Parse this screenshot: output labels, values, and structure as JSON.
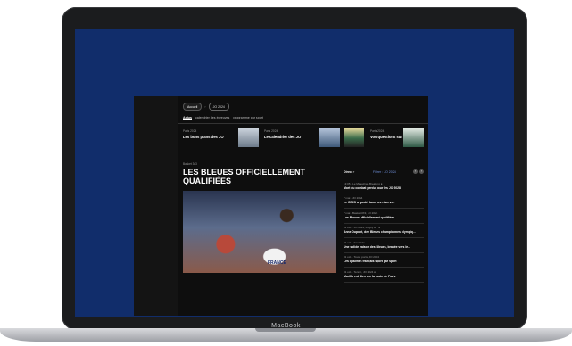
{
  "device": {
    "brand": "MacBook"
  },
  "site": {
    "pills": [
      {
        "label": "Accueil",
        "active": true
      },
      {
        "label": "JO 2024",
        "active": false
      }
    ],
    "pill_separator": "›",
    "subnav": [
      {
        "label": "Actus",
        "active": true
      },
      {
        "label": "calendrier des épreuves",
        "active": false
      },
      {
        "label": "programme par sport",
        "active": false
      }
    ],
    "cards": [
      {
        "tag": "Paris 2024",
        "title": "Les bons plans des JO",
        "thumb": "thumb1"
      },
      {
        "tag": "Paris 2024",
        "title": "Le calendrier des JO",
        "thumb": "thumb2"
      },
      {
        "tag": "Paris 2024",
        "title": "Vos questions sur les JO",
        "thumb": "thumb3"
      },
      {
        "tag": "",
        "title": "",
        "thumb": "thumb4"
      }
    ],
    "article": {
      "kicker": "Basket 3x3",
      "headline": "LES BLEUES OFFICIELLEMENT QUALIFIÉES",
      "jersey_text": "FRANCE"
    },
    "news": {
      "live_label": "Direct ›",
      "filter_label": "Filtrer : JO 2024",
      "prev_icon": "‹",
      "next_icon": "›",
      "items": [
        {
          "meta": "13:05 · Le Magazine, Breaking ●",
          "text": "Mort du combat perdu pour les JO 2028"
        },
        {
          "meta": "7 mai · JO 2024",
          "text": "Le CEJO a posté dans ses réserves"
        },
        {
          "meta": "7 mai · Basket 3X3, JO 2024",
          "text": "Les Bleues officiellement qualifiées"
        },
        {
          "meta": "31 oct. · JO 2024, Rugby à 7 ●",
          "text": "Anne Dupont, des Bleues championnes olympiq..."
        },
        {
          "meta": "31 oct. · Escalade",
          "text": "Une solide saison des Bleues, bravée vers le..."
        },
        {
          "meta": "31 oct. · Tous sports, JO 2024",
          "text": "Les qualifiés français sport par sport"
        },
        {
          "meta": "31 oct. · Tennis, JO 2024 ●",
          "text": "Murillo est bien sur la route de Paris"
        }
      ]
    }
  }
}
